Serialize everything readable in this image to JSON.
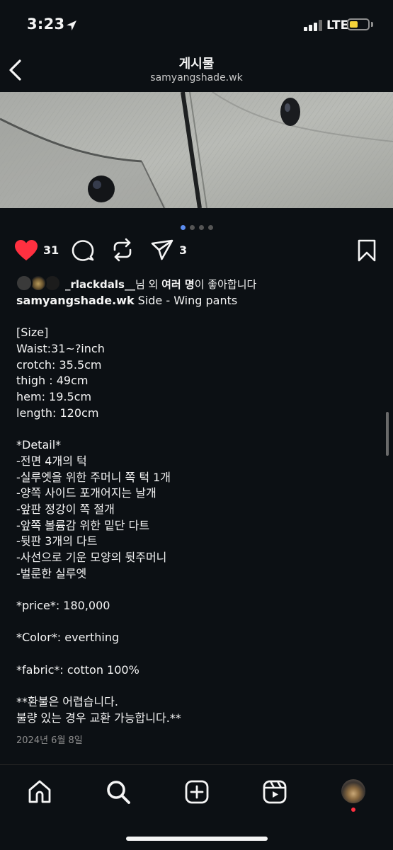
{
  "status_bar": {
    "time": "3:23",
    "network": "LTE",
    "battery_level": 0.45
  },
  "header": {
    "title": "게시물",
    "subtitle": "samyangshade.wk"
  },
  "carousel": {
    "total": 4,
    "active_index": 1
  },
  "actions": {
    "like_count": "31",
    "share_count": "3"
  },
  "likes_line": {
    "username": "_rlackdals__",
    "text_1": "님 외 ",
    "others": "여러 명",
    "text_2": "이 좋아합니다"
  },
  "caption": {
    "author": "samyangshade.wk",
    "first_line": " Side - Wing pants",
    "lines": [
      "",
      "[Size]",
      "Waist:31~?inch",
      "crotch: 35.5cm",
      "thigh : 49cm",
      "hem: 19.5cm",
      "length: 120cm",
      "",
      "*Detail*",
      "-전면 4개의 턱",
      "-실루엣을 위한 주머니 쪽 턱 1개",
      "-양쪽 사이드 포개어지는 날개",
      "-앞판 정강이 쪽 절개",
      "-앞쪽 볼륨감 위한 밑단 다트",
      "-뒷판 3개의 다트",
      "-사선으로 기운 모양의 뒷주머니",
      "-벌룬한 실루엣",
      "",
      "*price*: 180,000",
      "",
      "*Color*: everthing",
      "",
      "*fabric*: cotton 100%",
      "",
      "**환불은 어렵습니다.",
      "불량 있는 경우 교환 가능합니다.**"
    ]
  },
  "post_date": "2024년 6월 8일",
  "icons": {
    "like": "heart-filled-icon",
    "comment": "comment-bubble-icon",
    "repost": "repost-icon",
    "share": "paper-plane-icon",
    "save": "bookmark-icon",
    "tabs": [
      "home-icon",
      "search-icon",
      "create-icon",
      "reels-icon",
      "profile-avatar"
    ]
  },
  "colors": {
    "background": "#0c1014",
    "like": "#ff3040",
    "carousel_active": "#5b8cf0",
    "notification_dot": "#ff3040"
  }
}
